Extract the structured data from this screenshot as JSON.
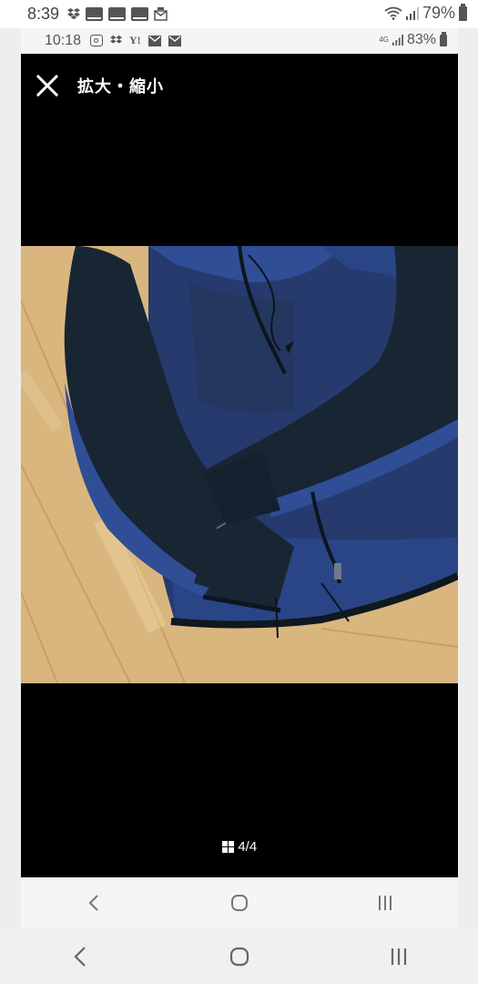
{
  "outer_status": {
    "time": "8:39",
    "battery": "79%",
    "notification_icons": [
      "dropbox-icon",
      "app-tile-icon",
      "app-tile-icon",
      "app-tile-icon",
      "mail-box-icon"
    ]
  },
  "inner_status": {
    "time": "10:18",
    "battery": "83%",
    "network": "4G",
    "yahoo": "Y!"
  },
  "viewer": {
    "zoom_label": "拡大・縮小",
    "counter": "4/4",
    "image_alt": "navy and blue zip-up jacket on wooden floor"
  },
  "colors": {
    "viewer_bg": "#000000",
    "jacket_dark": "#182634",
    "jacket_blue": "#2f4e96",
    "floor": "#d9b67e"
  }
}
